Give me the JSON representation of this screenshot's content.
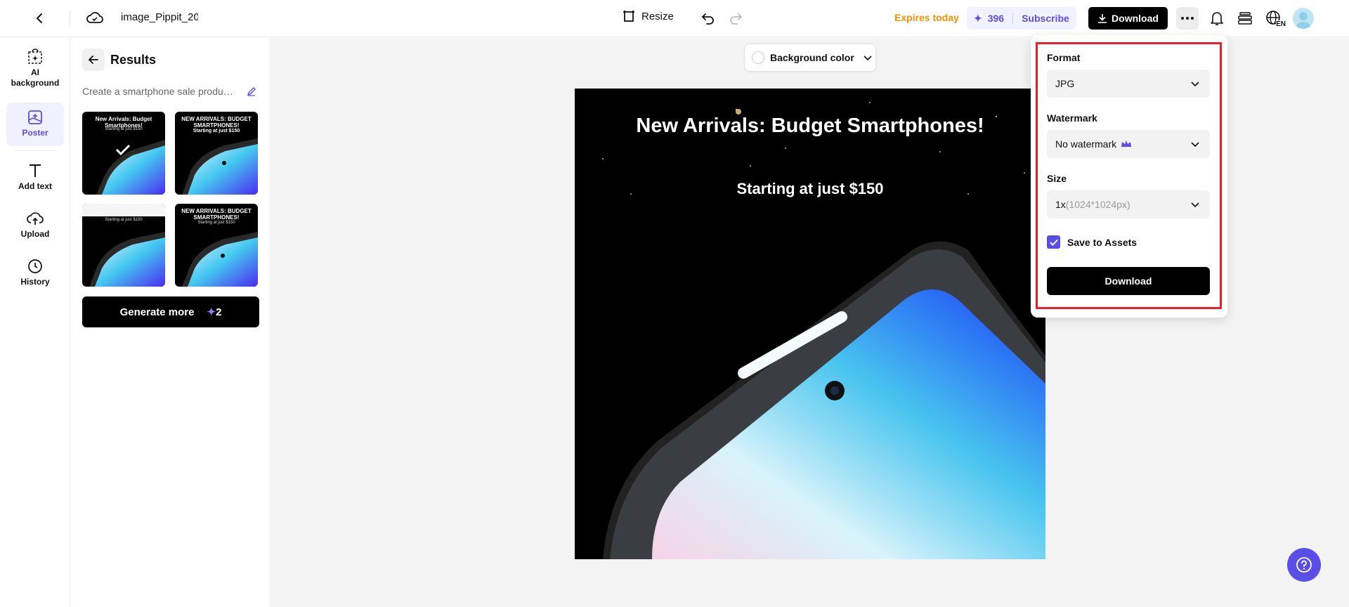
{
  "header": {
    "filename": "image_Pippit_20",
    "resize_label": "Resize",
    "expires_label": "Expires today",
    "credits": "396",
    "subscribe_label": "Subscribe",
    "download_label": "Download",
    "language_badge": "EN"
  },
  "rail": {
    "items": [
      {
        "label": "AI background"
      },
      {
        "label": "Poster"
      },
      {
        "label": "Add text"
      },
      {
        "label": "Upload"
      },
      {
        "label": "History"
      }
    ]
  },
  "results": {
    "title": "Results",
    "prompt": "Create a smartphone sale product poster",
    "thumbnails": [
      {
        "title": "New Arrivals: Budget Smartphones!",
        "subtitle": "Starting at just $150",
        "selected": true
      },
      {
        "title": "NEW ARRIVALS: BUDGET SMARTPHONES!",
        "subtitle": "Starting at just $150"
      },
      {
        "title": "",
        "subtitle": "Starting at just $150"
      },
      {
        "title": "NEW ARRIVALS: BUDGET SMARTPHONES!",
        "subtitle": "Starting at just $150"
      }
    ],
    "generate_more_label": "Generate more",
    "generate_more_cost": "2"
  },
  "canvas": {
    "background_color_label": "Background color",
    "poster_title": "New Arrivals: Budget Smartphones!",
    "poster_subtitle": "Starting at just $150"
  },
  "download_panel": {
    "format_label": "Format",
    "format_value": "JPG",
    "watermark_label": "Watermark",
    "watermark_value": "No watermark",
    "size_label": "Size",
    "size_value": "1x",
    "size_detail": "(1024*1024px)",
    "save_to_assets_label": "Save to Assets",
    "save_to_assets_checked": true,
    "download_button_label": "Download"
  },
  "colors": {
    "accent": "#5a4ee6",
    "expires": "#f29100",
    "highlight_frame": "#e8202e"
  }
}
